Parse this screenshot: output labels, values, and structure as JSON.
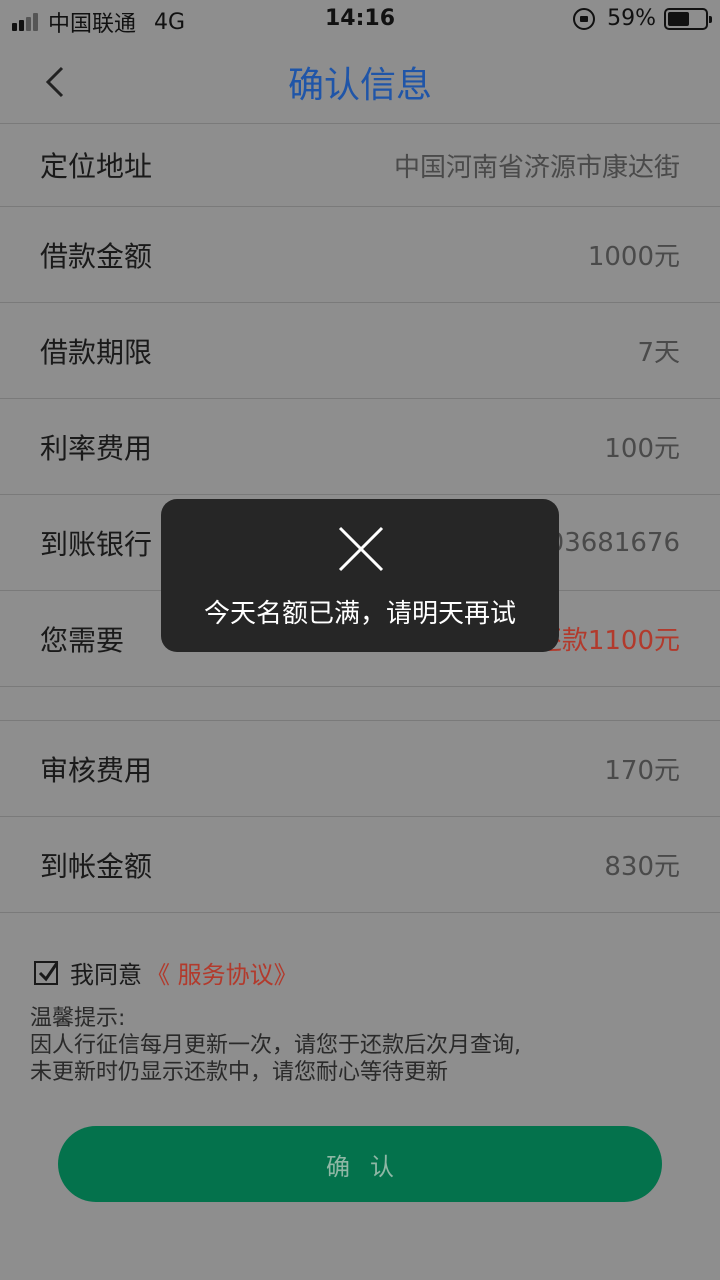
{
  "status_bar": {
    "carrier": "中国联通",
    "network": "4G",
    "time": "14:16",
    "battery": "59%",
    "battery_level": 0.59
  },
  "nav": {
    "title": "确认信息"
  },
  "rows": [
    {
      "label": "定位地址",
      "value": "中国河南省济源市康达街"
    },
    {
      "label": "借款金额",
      "value": "1000元"
    },
    {
      "label": "借款期限",
      "value": "7天"
    },
    {
      "label": "利率费用",
      "value": "100元"
    },
    {
      "label": "到账银行",
      "value": "03681676"
    },
    {
      "label": "您需要",
      "value": "还款1100元"
    }
  ],
  "rows2": [
    {
      "label": "审核费用",
      "value": "170元"
    },
    {
      "label": "到帐金额",
      "value": "830元"
    }
  ],
  "agreement": {
    "text": "我同意",
    "link": "《 服务协议》",
    "checked": true
  },
  "tips": {
    "title": "温馨提示:",
    "line1": "因人行征信每月更新一次，请您于还款后次月查询,",
    "line2": "未更新时仍显示还款中，请您耐心等待更新"
  },
  "confirm_button": "确认",
  "toast": {
    "icon": "close-icon",
    "message": "今天名额已满，请明天再试"
  },
  "colors": {
    "title_blue": "#1f55a8",
    "highlight_red": "#b23a2c",
    "button_green": "#04724c",
    "overlay_gray": "#8e8e8e"
  }
}
